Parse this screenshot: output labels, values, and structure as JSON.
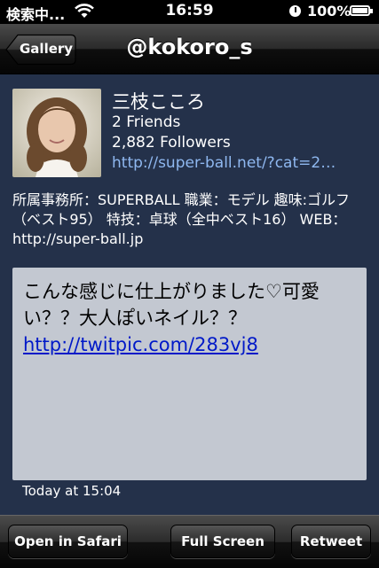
{
  "status_bar": {
    "carrier": "検索中...",
    "time": "16:59",
    "battery": "100%"
  },
  "nav": {
    "back_label": "Gallery",
    "title": "@kokoro_s"
  },
  "profile": {
    "name": "三枝こころ",
    "friends": "2 Friends",
    "followers": "2,882 Followers",
    "url": "http://super-ball.net/?cat=2…",
    "bio": "所属事務所：SUPERBALL 職業：モデル 趣味:ゴルフ（ベスト95） 特技：卓球（全中ベスト16） WEB：http://super-ball.jp"
  },
  "tweet": {
    "text": "こんな感じに仕上がりました♡可愛い？？大人ぽいネイル？？",
    "link": "http://twitpic.com/283vj8",
    "timestamp": "Today at 15:04"
  },
  "toolbar": {
    "open_in_safari": "Open in Safari",
    "full_screen": "Full Screen",
    "retweet": "Retweet"
  },
  "colors": {
    "content_bg": "#24314a",
    "tweet_bg": "#c3c8d1",
    "link": "#0019c8",
    "profile_link": "#8fb8f0"
  },
  "icons": [
    "wifi-icon",
    "alarm-clock-icon",
    "battery-icon"
  ]
}
